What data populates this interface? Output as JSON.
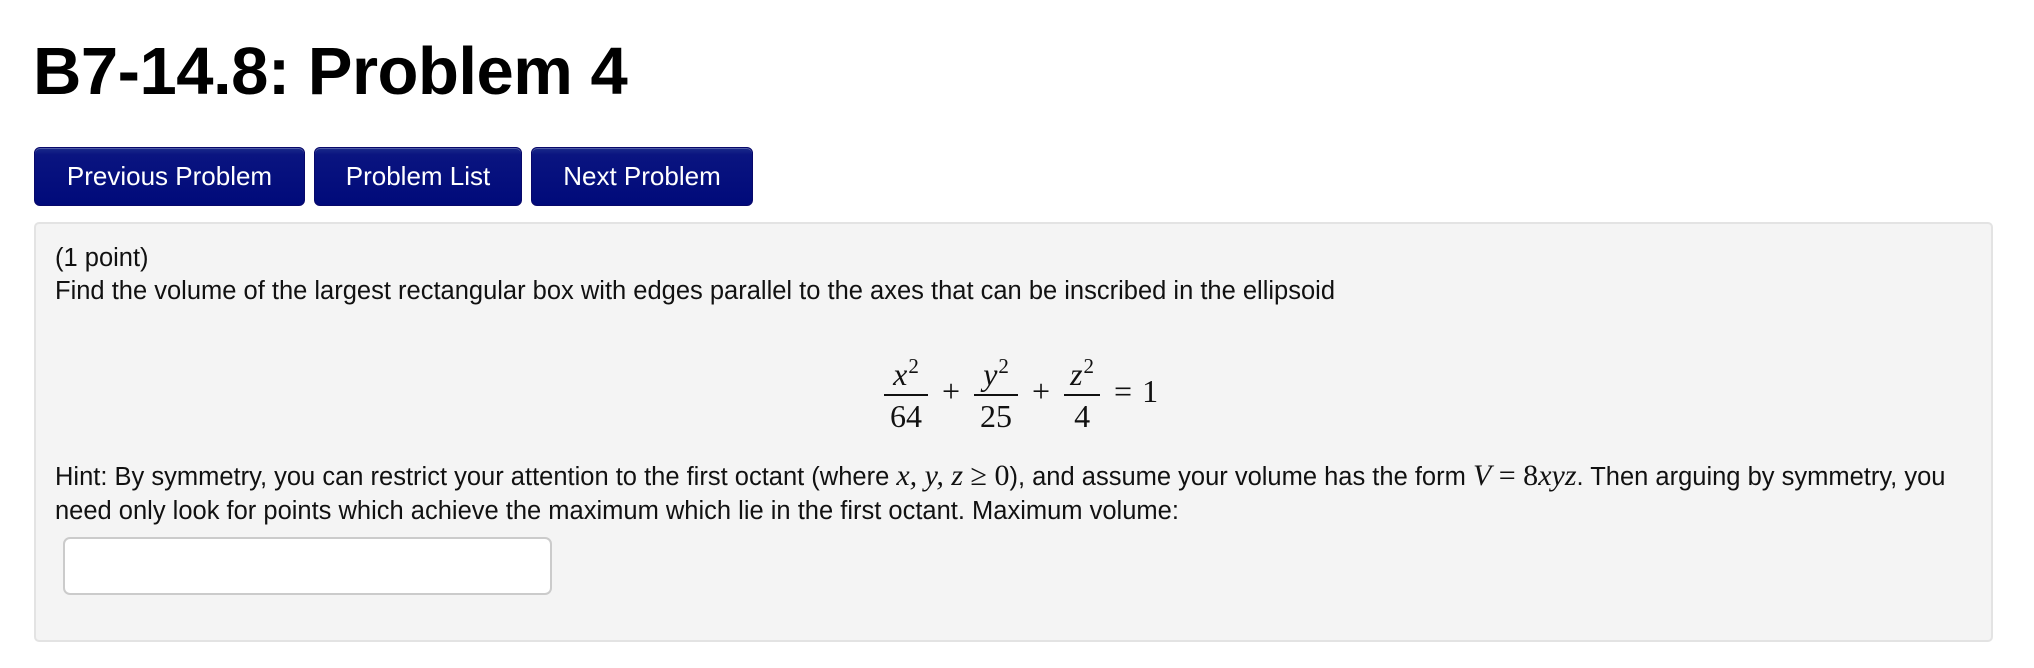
{
  "page": {
    "title": "B7-14.8: Problem 4"
  },
  "nav": {
    "previous_label": "Previous Problem",
    "list_label": "Problem List",
    "next_label": "Next Problem",
    "button_color": "#000a7a"
  },
  "problem": {
    "points": "(1 point)",
    "question": "Find the volume of the largest rectangular box with edges parallel to the axes that can be inscribed in the ellipsoid",
    "equation": {
      "terms": [
        {
          "numerator": "x",
          "exponent": "2",
          "denominator": "64"
        },
        {
          "numerator": "y",
          "exponent": "2",
          "denominator": "25"
        },
        {
          "numerator": "z",
          "exponent": "2",
          "denominator": "4"
        }
      ],
      "plus": "+",
      "equals": "=",
      "rhs": "1"
    },
    "hint": {
      "part1": "Hint: By symmetry, you can restrict your attention to the first octant (where ",
      "math1": "x, y, z",
      "math1_op": " ≥ 0",
      "part2": "), and assume your volume has the form ",
      "math2_v": "V",
      "math2_eq": " = 8",
      "math2_xyz": "xyz",
      "part3": ". Then arguing by symmetry, you need only look for points which achieve the maximum which lie in the first octant. Maximum volume:"
    },
    "answer": {
      "value": "",
      "placeholder": ""
    }
  }
}
